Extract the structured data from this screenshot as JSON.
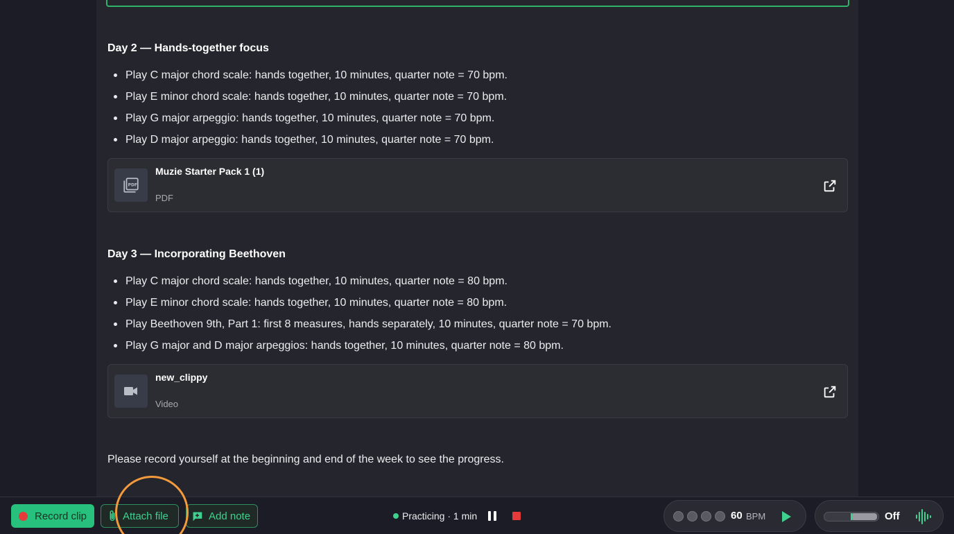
{
  "colors": {
    "page_bg": "#1c1c26",
    "panel_bg": "#25252d",
    "accent_green": "#27c07d",
    "record_red": "#e53b3b",
    "highlight_orange": "#f39a3c"
  },
  "days": [
    {
      "heading": "Day 2 — Hands-together focus",
      "tasks": [
        "Play C major chord scale: hands together, 10 minutes, quarter note = 70 bpm.",
        "Play E minor chord scale: hands together, 10 minutes, quarter note = 70 bpm.",
        "Play G major arpeggio: hands together, 10 minutes, quarter note = 70 bpm.",
        "Play D major arpeggio: hands together, 10 minutes, quarter note = 70 bpm."
      ],
      "attachment": {
        "title": "Muzie Starter Pack 1 (1)",
        "type": "PDF",
        "icon": "pdf-icon"
      }
    },
    {
      "heading": "Day 3 — Incorporating Beethoven",
      "tasks": [
        "Play C major chord scale: hands together, 10 minutes, quarter note = 80 bpm.",
        "Play E minor chord scale: hands together, 10 minutes, quarter note = 80 bpm.",
        "Play Beethoven 9th, Part 1: first 8 measures, hands separately, 10 minutes, quarter note = 70 bpm.",
        "Play G major and D major arpeggios: hands together, 10 minutes, quarter note = 80 bpm."
      ],
      "attachment": {
        "title": "new_clippy",
        "type": "Video",
        "icon": "video-camera-icon"
      }
    }
  ],
  "footer_note": "Please record yourself at the beginning and end of the week to see the progress.",
  "toolbar": {
    "record_label": "Record clip",
    "attach_label": "Attach file",
    "note_label": "Add note"
  },
  "practice": {
    "status": "Practicing · 1 min"
  },
  "metronome": {
    "bpm": "60",
    "unit": "BPM",
    "beats": 4
  },
  "audio_toggle": {
    "state_label": "Off"
  }
}
